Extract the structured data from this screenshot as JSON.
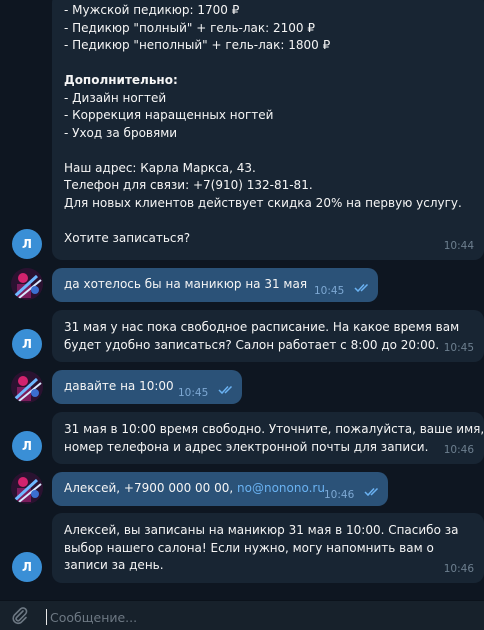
{
  "messages": [
    {
      "author": "bot",
      "lines": [
        "- Мужской педикюр: 1700 ₽",
        "- Педикюр \"полный\" + гель-лак: 2100 ₽",
        "- Педикюр \"неполный\" + гель-лак: 1800 ₽",
        "",
        "Дополнительно:",
        "- Дизайн ногтей",
        "- Коррекция наращенных ногтей",
        "- Уход за бровями",
        "",
        "Наш адрес: Карла Маркса, 43.",
        "Телефон для связи: +7(910) 132-81-81.",
        "Для новых клиентов действует скидка 20% на первую услугу.",
        "",
        "Хотите записаться?"
      ],
      "time": "10:44",
      "avatar_letter": "Л"
    },
    {
      "author": "user",
      "text": "да хотелось бы на маникюр на 31 мая",
      "time": "10:45",
      "status": "read"
    },
    {
      "author": "bot",
      "lines": [
        "31 мая у нас пока свободное расписание. На какое время вам",
        "будет удобно записаться? Салон работает с 8:00 до 20:00."
      ],
      "time": "10:45",
      "avatar_letter": "Л"
    },
    {
      "author": "user",
      "text": "давайте на 10:00",
      "time": "10:45",
      "status": "read"
    },
    {
      "author": "bot",
      "lines": [
        "31 мая в 10:00 время свободно. Уточните, пожалуйста, ваше имя,",
        "номер телефона и адрес электронной почты для записи."
      ],
      "time": "10:46",
      "avatar_letter": "Л"
    },
    {
      "author": "user",
      "text_prefix": "Алексей, +7900 000 00 00, ",
      "link": "no@nonono.ru",
      "time": "10:46",
      "status": "read"
    },
    {
      "author": "bot",
      "lines": [
        "Алексей, вы записаны на маникюр 31 мая в 10:00. Спасибо за",
        "выбор нашего салона! Если нужно, могу напомнить вам о",
        "записи за день."
      ],
      "time": "10:46",
      "avatar_letter": "Л"
    }
  ],
  "composer": {
    "placeholder": "Сообщение...",
    "attach_icon": "paperclip-icon"
  },
  "colors": {
    "background": "#0e1621",
    "incoming_bubble": "#182533",
    "outgoing_bubble": "#2b5278",
    "avatar": "#3a8fd6",
    "link": "#6ab2f2",
    "read_ticks": "#6ab2f2"
  }
}
